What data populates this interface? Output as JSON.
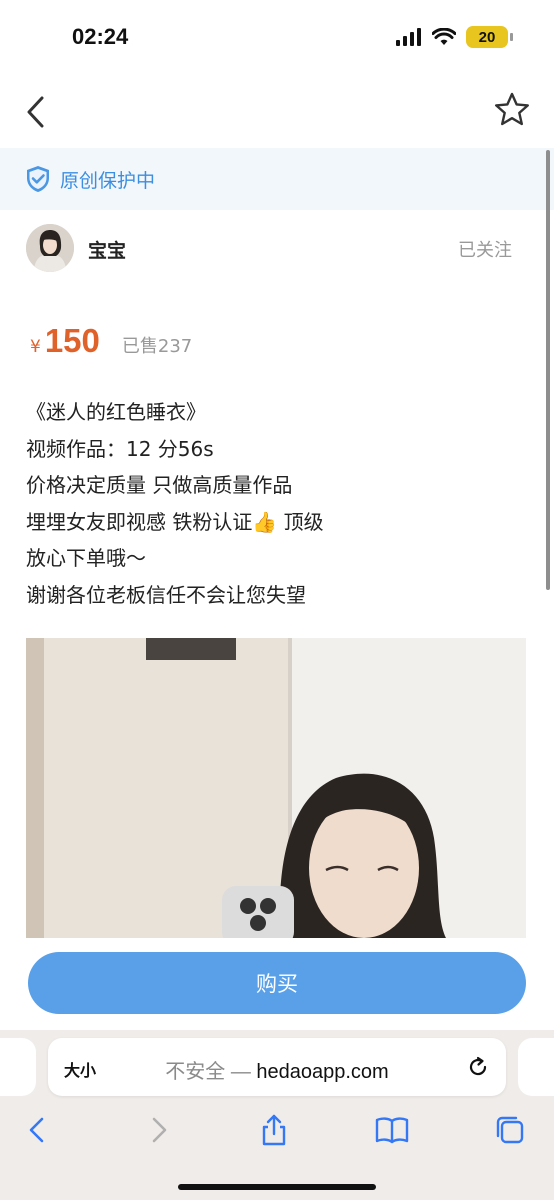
{
  "status_bar": {
    "time": "02:24",
    "battery": "20"
  },
  "protection": {
    "label": "原创保护中"
  },
  "author": {
    "name": "宝宝",
    "follow_label": "已关注"
  },
  "price": {
    "currency": "¥",
    "amount": "150",
    "sold": "已售237"
  },
  "description": {
    "lines": [
      "《迷人的红色睡衣》",
      "视频作品：12 分56s",
      "价格决定质量 只做高质量作品",
      "埋埋女友即视感 铁粉认证",
      "放心下单哦～",
      "谢谢各位老板信任不会让您失望"
    ],
    "line4_emoji": "👍",
    "line4_tail": " 顶级"
  },
  "buy_button": {
    "label": "购买"
  },
  "browser": {
    "text_size_label": "大小",
    "insecure_label": "不安全 — ",
    "domain": "hedaoapp.com"
  },
  "colors": {
    "accent": "#e0622b",
    "button": "#5aa0e8",
    "protect_text": "#3c8ee0"
  }
}
